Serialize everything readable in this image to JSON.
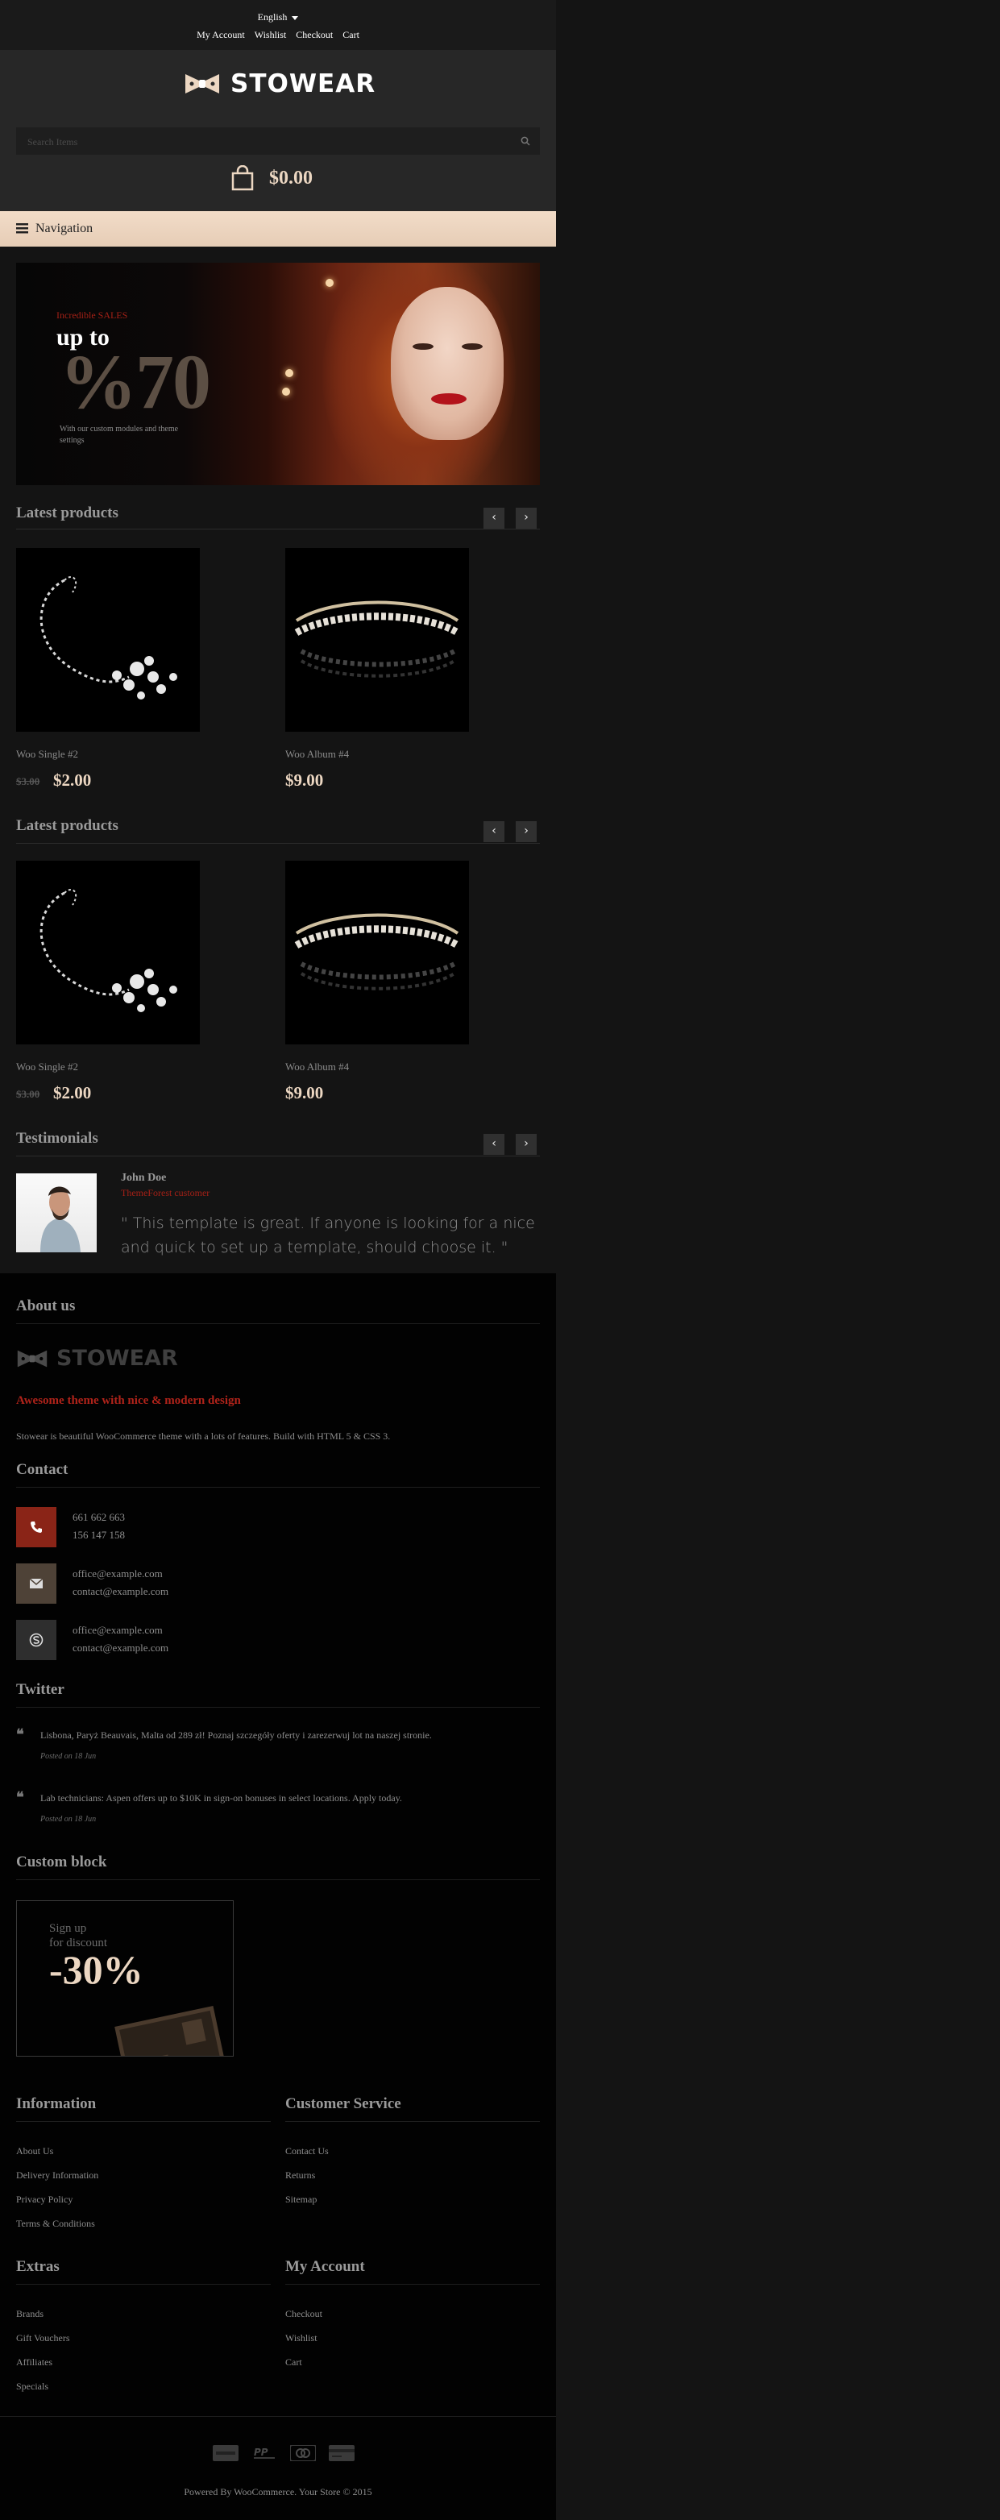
{
  "topbar": {
    "language": "English",
    "links": [
      "My Account",
      "Wishlist",
      "Checkout",
      "Cart"
    ]
  },
  "header": {
    "logo_text": "STOWEAR",
    "search_placeholder": "Search Items",
    "cart_total": "$0.00"
  },
  "nav": {
    "label": "Navigation"
  },
  "banner": {
    "eyebrow": "Incredible SALES",
    "headline": "up to",
    "percent": "%70",
    "description": "With our custom modules and theme settings"
  },
  "latest1": {
    "title": "Latest products",
    "products": [
      {
        "name": "Woo Single #2",
        "old_price": "$3.00",
        "price": "$2.00"
      },
      {
        "name": "Woo Album #4",
        "old_price": "",
        "price": "$9.00"
      }
    ]
  },
  "latest2": {
    "title": "Latest products",
    "products": [
      {
        "name": "Woo Single #2",
        "old_price": "$3.00",
        "price": "$2.00"
      },
      {
        "name": "Woo Album #4",
        "old_price": "",
        "price": "$9.00"
      }
    ]
  },
  "testimonials": {
    "title": "Testimonials",
    "name": "John Doe",
    "role": "ThemeForest customer",
    "quote": "\" This template is great. If anyone is looking for a nice and quick to set up a template, should choose it. \""
  },
  "about": {
    "title": "About us",
    "logo_text": "STOWEAR",
    "tagline": "Awesome theme with nice & modern design",
    "text": "Stowear is beautiful WooCommerce theme with a lots of features. Build with HTML 5 & CSS 3."
  },
  "contact": {
    "title": "Contact",
    "phones": [
      "661 662 663",
      "156 147 158"
    ],
    "emails": [
      "office@example.com",
      "contact@example.com"
    ],
    "skype": [
      "office@example.com",
      "contact@example.com"
    ]
  },
  "twitter": {
    "title": "Twitter",
    "tweets": [
      {
        "text": "Lisbona, Paryż Beauvais, Malta od 289 zł! Poznaj szczegóły oferty i zarezerwuj lot na naszej stronie.",
        "date": "Posted on 18 Jun"
      },
      {
        "text": "Lab technicians: Aspen offers up to $10K in sign-on bonuses in select locations. Apply today.",
        "date": "Posted on 18 Jun"
      }
    ]
  },
  "custom_block": {
    "title": "Custom block",
    "line1": "Sign up",
    "line2": "for discount",
    "discount": "-30%"
  },
  "footer_links": {
    "information": {
      "title": "Information",
      "items": [
        "About Us",
        "Delivery Information",
        "Privacy Policy",
        "Terms & Conditions"
      ]
    },
    "customer_service": {
      "title": "Customer Service",
      "items": [
        "Contact Us",
        "Returns",
        "Sitemap"
      ]
    },
    "extras": {
      "title": "Extras",
      "items": [
        "Brands",
        "Gift Vouchers",
        "Affiliates",
        "Specials"
      ]
    },
    "my_account": {
      "title": "My Account",
      "items": [
        "Checkout",
        "Wishlist",
        "Cart"
      ]
    }
  },
  "payment_icons": [
    "amex-icon",
    "paypal-icon",
    "mastercard-icon",
    "credit-card-icon"
  ],
  "copyright": "Powered By WooCommerce. Your Store © 2015",
  "colors": {
    "accent": "#ecd7c2",
    "red": "#a32016",
    "background": "#141414"
  }
}
